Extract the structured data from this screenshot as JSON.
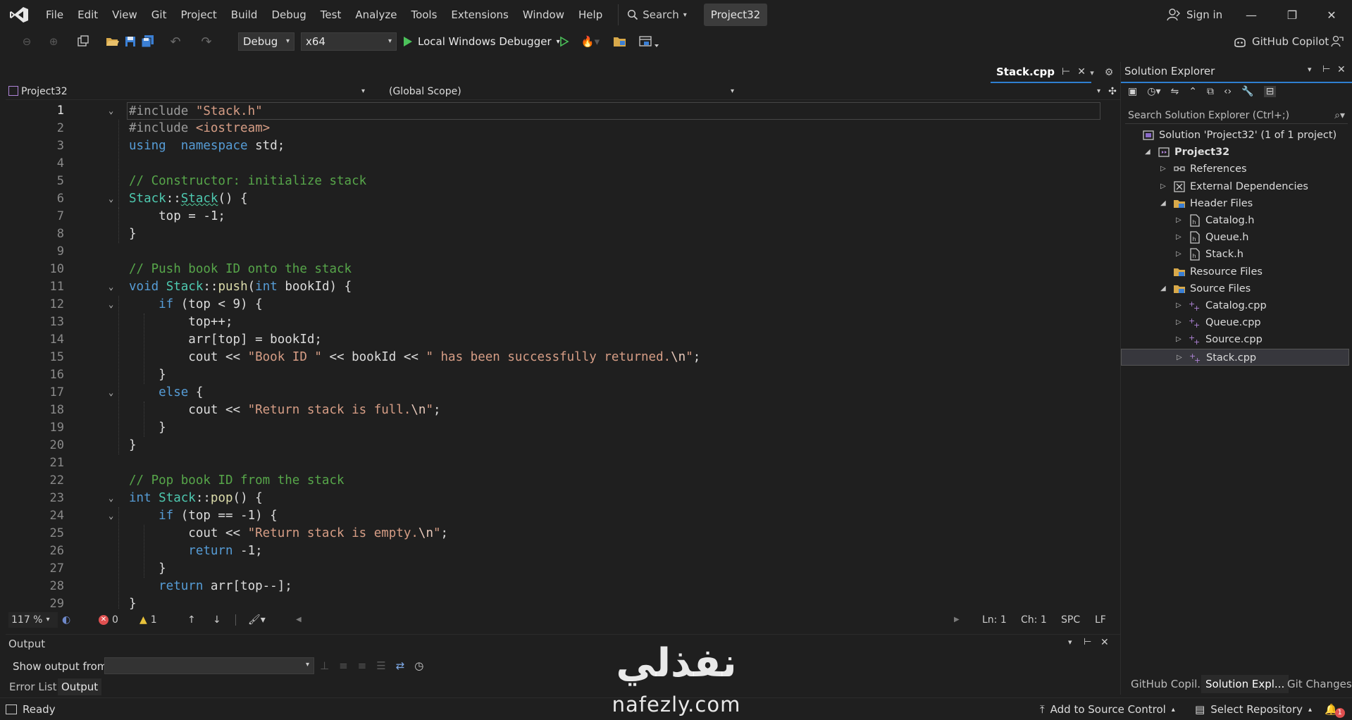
{
  "menubar": {
    "items": [
      "File",
      "Edit",
      "View",
      "Git",
      "Project",
      "Build",
      "Debug",
      "Test",
      "Analyze",
      "Tools",
      "Extensions",
      "Window",
      "Help"
    ],
    "search_label": "Search",
    "solution_name": "Project32",
    "signin_label": "Sign in"
  },
  "toolbar": {
    "configuration": "Debug",
    "platform": "x64",
    "debugger_label": "Local Windows Debugger",
    "copilot_label": "GitHub Copilot"
  },
  "editor": {
    "tab_label": "Stack.cpp",
    "nav_project": "Project32",
    "nav_scope": "(Global Scope)",
    "current_line": 1,
    "lines": [
      [
        [
          "pp",
          "#include "
        ],
        [
          "str",
          "\"Stack.h\""
        ]
      ],
      [
        [
          "pp",
          "#include "
        ],
        [
          "str",
          "<iostream>"
        ]
      ],
      [
        [
          "kw",
          "using"
        ],
        [
          "",
          "  "
        ],
        [
          "kw",
          "namespace"
        ],
        [
          "",
          " std;"
        ]
      ],
      [],
      [
        [
          "cm",
          "// Constructor: initialize stack"
        ]
      ],
      [
        [
          "ty",
          "Stack"
        ],
        [
          "",
          "::"
        ],
        [
          "ty wavy",
          "Stack"
        ],
        [
          "",
          "() {"
        ]
      ],
      [
        [
          "",
          "    top = -1;"
        ]
      ],
      [
        [
          "",
          "}"
        ]
      ],
      [],
      [
        [
          "cm",
          "// Push book ID onto the stack"
        ]
      ],
      [
        [
          "kw",
          "void"
        ],
        [
          "",
          " "
        ],
        [
          "ty",
          "Stack"
        ],
        [
          "",
          "::"
        ],
        [
          "fn",
          "push"
        ],
        [
          "",
          "("
        ],
        [
          "kw",
          "int"
        ],
        [
          "",
          " bookId) {"
        ]
      ],
      [
        [
          "",
          ""
        ],
        [
          "kw",
          "    if"
        ],
        [
          "",
          " (top < 9) {"
        ]
      ],
      [
        [
          "",
          "        top++;"
        ]
      ],
      [
        [
          "",
          "        arr[top] = bookId;"
        ]
      ],
      [
        [
          "",
          "        cout << "
        ],
        [
          "str",
          "\"Book ID \""
        ],
        [
          "",
          " << bookId << "
        ],
        [
          "str",
          "\" has been successfully returned."
        ],
        [
          "esc",
          "\\n"
        ],
        [
          "str",
          "\""
        ],
        [
          "",
          ";"
        ]
      ],
      [
        [
          "",
          "    }"
        ]
      ],
      [
        [
          "kw",
          "    else"
        ],
        [
          "",
          " {"
        ]
      ],
      [
        [
          "",
          "        cout << "
        ],
        [
          "str",
          "\"Return stack is full."
        ],
        [
          "esc",
          "\\n"
        ],
        [
          "str",
          "\""
        ],
        [
          "",
          ";"
        ]
      ],
      [
        [
          "",
          "    }"
        ]
      ],
      [
        [
          "",
          "}"
        ]
      ],
      [],
      [
        [
          "cm",
          "// Pop book ID from the stack"
        ]
      ],
      [
        [
          "kw",
          "int"
        ],
        [
          "",
          " "
        ],
        [
          "ty",
          "Stack"
        ],
        [
          "",
          "::"
        ],
        [
          "fn",
          "pop"
        ],
        [
          "",
          "() {"
        ]
      ],
      [
        [
          "kw",
          "    if"
        ],
        [
          "",
          " (top == -1) {"
        ]
      ],
      [
        [
          "",
          "        cout << "
        ],
        [
          "str",
          "\"Return stack is empty."
        ],
        [
          "esc",
          "\\n"
        ],
        [
          "str",
          "\""
        ],
        [
          "",
          ";"
        ]
      ],
      [
        [
          "kw",
          "        return"
        ],
        [
          "",
          " -1;"
        ]
      ],
      [
        [
          "",
          "    }"
        ]
      ],
      [
        [
          "kw",
          "    return"
        ],
        [
          "",
          " arr[top--];"
        ]
      ],
      [
        [
          "",
          "}"
        ]
      ]
    ],
    "fold_lines": [
      1,
      6,
      11,
      12,
      17,
      23,
      24
    ]
  },
  "editor_status": {
    "zoom": "117 %",
    "errors": "0",
    "warnings": "1",
    "line": "Ln: 1",
    "char": "Ch: 1",
    "whitespace": "SPC",
    "line_ending": "LF"
  },
  "output": {
    "title": "Output",
    "show_from_label": "Show output from:",
    "show_from_value": "",
    "tabs": [
      "Error List",
      "Output"
    ]
  },
  "solution_explorer": {
    "title": "Solution Explorer",
    "search_placeholder": "Search Solution Explorer (Ctrl+;)",
    "tree": [
      {
        "label": "Solution 'Project32' (1 of 1 project)",
        "depth": 0,
        "arrow": "",
        "icon": "solution-icon"
      },
      {
        "label": "Project32",
        "depth": 1,
        "arrow": "open",
        "icon": "project-icon",
        "bold": true
      },
      {
        "label": "References",
        "depth": 2,
        "arrow": "closed",
        "icon": "references-icon"
      },
      {
        "label": "External Dependencies",
        "depth": 2,
        "arrow": "closed",
        "icon": "external-dependencies-icon"
      },
      {
        "label": "Header Files",
        "depth": 2,
        "arrow": "open",
        "icon": "folder-icon"
      },
      {
        "label": "Catalog.h",
        "depth": 3,
        "arrow": "closed",
        "icon": "header-file-icon"
      },
      {
        "label": "Queue.h",
        "depth": 3,
        "arrow": "closed",
        "icon": "header-file-icon"
      },
      {
        "label": "Stack.h",
        "depth": 3,
        "arrow": "closed",
        "icon": "header-file-icon"
      },
      {
        "label": "Resource Files",
        "depth": 2,
        "arrow": "",
        "icon": "folder-icon"
      },
      {
        "label": "Source Files",
        "depth": 2,
        "arrow": "open",
        "icon": "folder-icon"
      },
      {
        "label": "Catalog.cpp",
        "depth": 3,
        "arrow": "closed",
        "icon": "cpp-file-icon"
      },
      {
        "label": "Queue.cpp",
        "depth": 3,
        "arrow": "closed",
        "icon": "cpp-file-icon"
      },
      {
        "label": "Source.cpp",
        "depth": 3,
        "arrow": "closed",
        "icon": "cpp-file-icon"
      },
      {
        "label": "Stack.cpp",
        "depth": 3,
        "arrow": "closed",
        "icon": "cpp-file-icon",
        "selected": true
      }
    ],
    "bottom_tabs": [
      "GitHub Copil...",
      "Solution Expl...",
      "Git Changes"
    ]
  },
  "statusbar": {
    "ready": "Ready",
    "add_source_control": "Add to Source Control",
    "select_repository": "Select Repository",
    "notifications": "1"
  },
  "watermark": {
    "arabic": "نفذلي",
    "latin": "nafezly.com"
  },
  "colors": {
    "keyword": "#569cd6",
    "comment": "#57a64a",
    "string": "#d69d85",
    "type": "#4ec9b0",
    "function": "#dcdcaa",
    "accent": "#2f7fd0",
    "background": "#1f1f1f"
  }
}
